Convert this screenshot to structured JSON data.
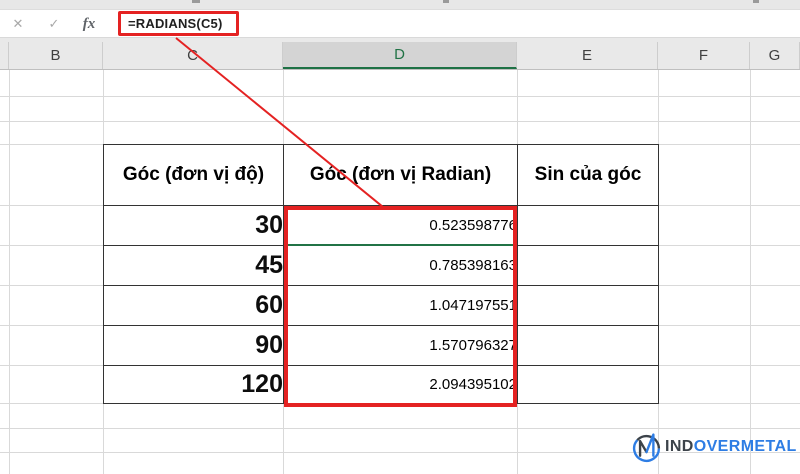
{
  "formula_bar": {
    "cancel_icon": "✕",
    "enter_icon": "✓",
    "fx_label": "fx",
    "formula": "=RADIANS(C5)"
  },
  "column_headers": {
    "labels": [
      "B",
      "C",
      "D",
      "E",
      "F",
      "G"
    ],
    "selected": "D"
  },
  "spreadsheet_table": {
    "headers": {
      "degrees": "Góc (đơn vị độ)",
      "radians": "Góc (đơn vị Radian)",
      "sin": "Sin của góc"
    },
    "rows": [
      {
        "degrees": "30",
        "radians": "0.523598776",
        "sin": ""
      },
      {
        "degrees": "45",
        "radians": "0.785398163",
        "sin": ""
      },
      {
        "degrees": "60",
        "radians": "1.047197551",
        "sin": ""
      },
      {
        "degrees": "90",
        "radians": "1.570796327",
        "sin": ""
      },
      {
        "degrees": "120",
        "radians": "2.094395102",
        "sin": ""
      }
    ]
  },
  "watermark": {
    "text_dark": "IND",
    "text_blue": "OVERMETAL"
  },
  "colors": {
    "annotation_red": "#e42222",
    "excel_green": "#217346",
    "header_yellow": "#ffff00",
    "selected_header_bg": "#d4d4d4"
  }
}
